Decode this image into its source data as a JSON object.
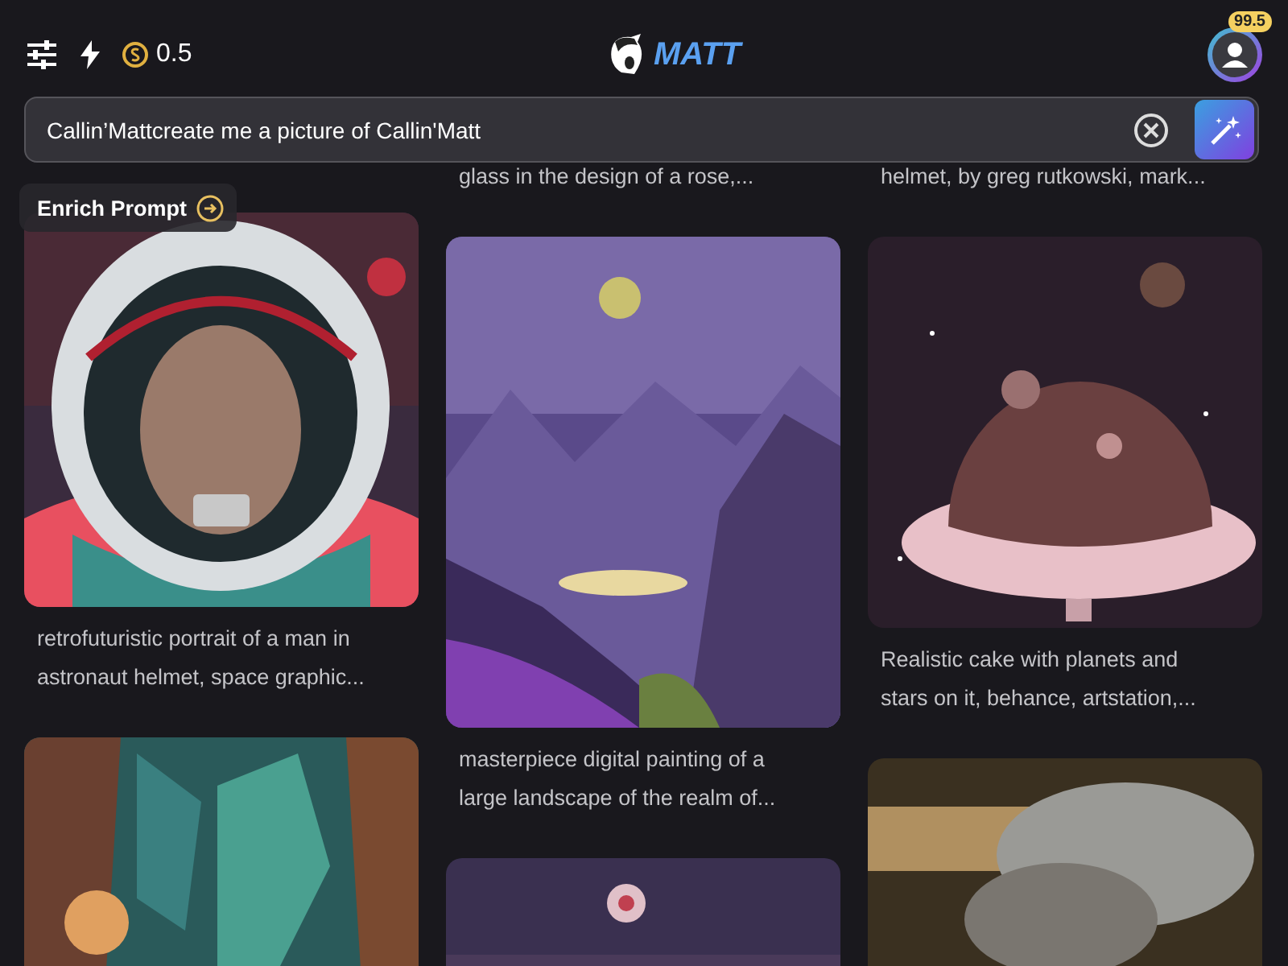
{
  "toolbar": {
    "credits": "0.5"
  },
  "logo": {
    "text": "MATT"
  },
  "account": {
    "badge": "99.5"
  },
  "prompt": {
    "value": "Callin’Mattcreate me a picture of Callin'Matt"
  },
  "enrich_button": {
    "label": "Enrich Prompt"
  },
  "gallery": {
    "columns": [
      [
        {
          "kind": "astronaut",
          "caption": "retrofuturistic portrait of a man in astronaut helmet, space graphic..."
        },
        {
          "kind": "forest"
        }
      ],
      [
        {
          "caption": "glass in the design of a rose,..."
        },
        {
          "kind": "landscape",
          "caption": "masterpiece digital painting of a large landscape of the realm of..."
        },
        {
          "kind": "orb"
        }
      ],
      [
        {
          "caption": "helmet, by greg rutkowski, mark..."
        },
        {
          "kind": "cake",
          "caption": "Realistic cake with planets and stars on it, behance, artstation,..."
        },
        {
          "kind": "smoke"
        }
      ]
    ]
  }
}
